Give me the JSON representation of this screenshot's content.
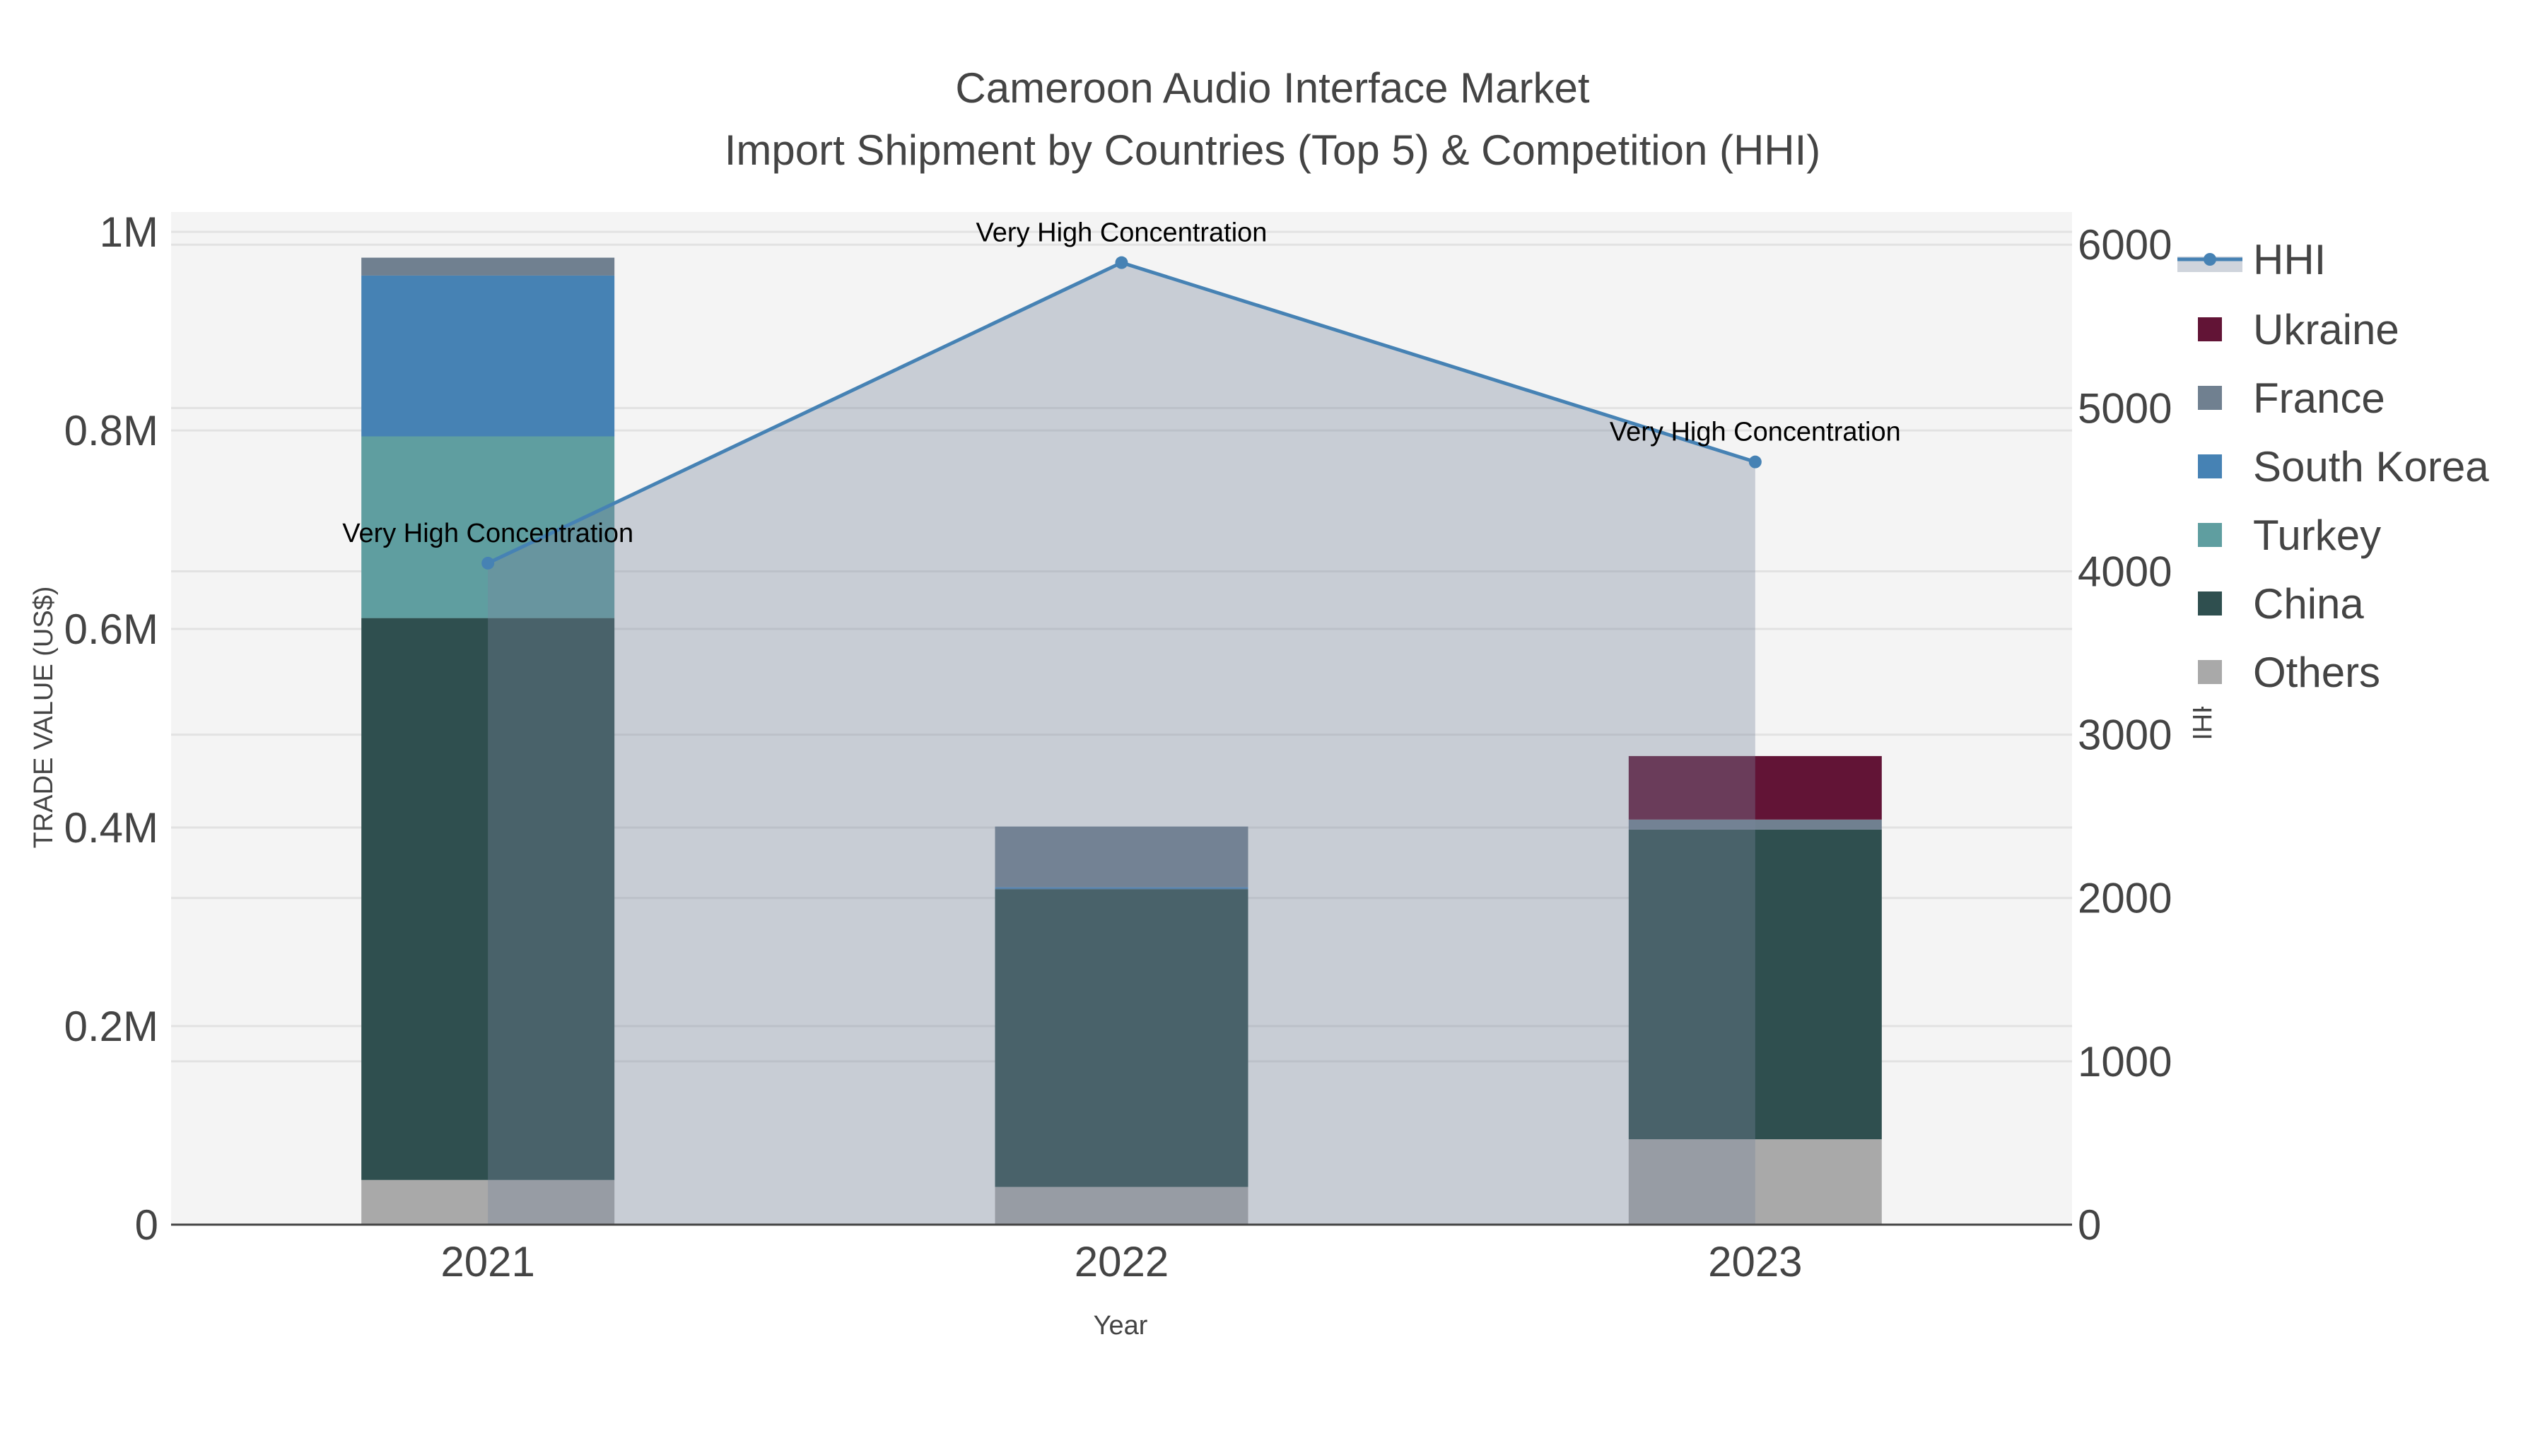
{
  "chart_data": {
    "type": "bar",
    "title": "Cameroon Audio Interface Market",
    "subtitle": "Import Shipment by Countries (Top 5) & Competition (HHI)",
    "xlabel": "Year",
    "ylabel": "TRADE VALUE (US$)",
    "y2label": "HHI",
    "categories": [
      "2021",
      "2022",
      "2023"
    ],
    "ylim": [
      0,
      1020000
    ],
    "y2lim": [
      0,
      6200
    ],
    "yticks": [
      {
        "v": 0,
        "label": "0"
      },
      {
        "v": 200000,
        "label": "0.2M"
      },
      {
        "v": 400000,
        "label": "0.4M"
      },
      {
        "v": 600000,
        "label": "0.6M"
      },
      {
        "v": 800000,
        "label": "0.8M"
      },
      {
        "v": 1000000,
        "label": "1M"
      }
    ],
    "y2ticks": [
      {
        "v": 0,
        "label": "0"
      },
      {
        "v": 1000,
        "label": "1000"
      },
      {
        "v": 2000,
        "label": "2000"
      },
      {
        "v": 3000,
        "label": "3000"
      },
      {
        "v": 4000,
        "label": "4000"
      },
      {
        "v": 5000,
        "label": "5000"
      },
      {
        "v": 6000,
        "label": "6000"
      }
    ],
    "series": [
      {
        "name": "Others",
        "color": "#a9a9a9",
        "values": [
          45000,
          38000,
          86000
        ]
      },
      {
        "name": "China",
        "color": "#2f4f4f",
        "values": [
          566000,
          300000,
          312000
        ]
      },
      {
        "name": "Turkey",
        "color": "#5f9ea0",
        "values": [
          183000,
          0,
          0
        ]
      },
      {
        "name": "South Korea",
        "color": "#4682b4",
        "values": [
          162000,
          2000,
          0
        ]
      },
      {
        "name": "France",
        "color": "#708090",
        "values": [
          18000,
          61000,
          10000
        ]
      },
      {
        "name": "Ukraine",
        "color": "#621436",
        "values": [
          0,
          0,
          64000
        ]
      }
    ],
    "hhi": {
      "name": "HHI",
      "color": "#4682b4",
      "values": [
        4050,
        5890,
        4670
      ]
    },
    "annotations": [
      "Very High Concentration",
      "Very High Concentration",
      "Very High Concentration"
    ],
    "legend_order": [
      "HHI",
      "Ukraine",
      "France",
      "South Korea",
      "Turkey",
      "China",
      "Others"
    ],
    "legend_position": "right",
    "grid": true
  }
}
